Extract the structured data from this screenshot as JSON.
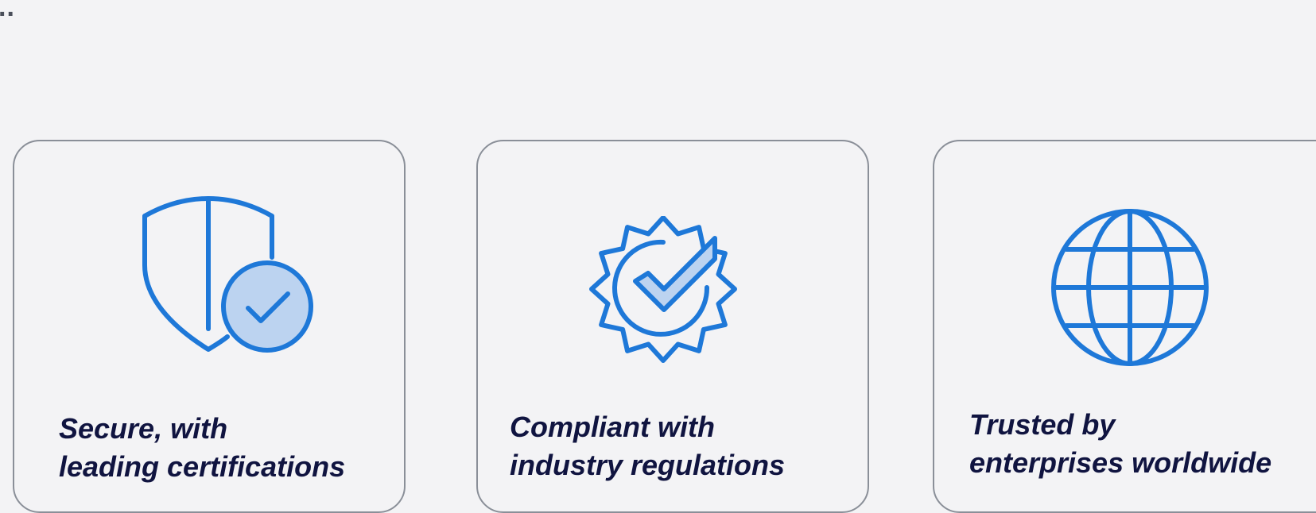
{
  "overflow_indicator": "..",
  "colors": {
    "background": "#f3f3f5",
    "card_border": "#8a8f98",
    "icon_stroke": "#1e78d8",
    "icon_fill": "#bcd3f0",
    "caption_text": "#101440"
  },
  "cards": [
    {
      "icon": "shield-check-icon",
      "caption_line1": "Secure, with",
      "caption_line2": "leading certifications"
    },
    {
      "icon": "verified-badge-icon",
      "caption_line1": "Compliant with",
      "caption_line2": "industry regulations"
    },
    {
      "icon": "globe-icon",
      "caption_line1": "Trusted by",
      "caption_line2": "enterprises worldwide"
    }
  ]
}
